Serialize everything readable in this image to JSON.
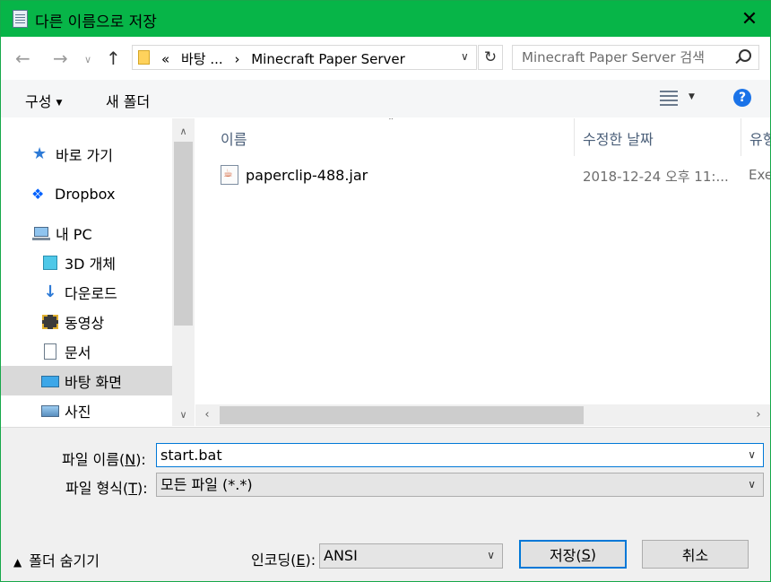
{
  "title_bar": {
    "title": "다른 이름으로 저장",
    "close_icon": "close-icon"
  },
  "address_bar": {
    "breadcrumbs": [
      "«",
      "바탕 ...",
      "›",
      "Minecraft Paper Server"
    ],
    "search_placeholder": "Minecraft Paper Server 검색"
  },
  "toolbar": {
    "organize_label": "구성",
    "new_folder_label": "새 폴더"
  },
  "nav_pane": {
    "items": [
      {
        "label": "바로 가기",
        "icon": "star-icon"
      },
      {
        "label": "Dropbox",
        "icon": "dropbox-icon"
      },
      {
        "label": "내 PC",
        "icon": "computer-icon"
      },
      {
        "label": "3D 개체",
        "icon": "cube-icon"
      },
      {
        "label": "다운로드",
        "icon": "download-icon"
      },
      {
        "label": "동영상",
        "icon": "video-icon"
      },
      {
        "label": "문서",
        "icon": "document-icon"
      },
      {
        "label": "바탕 화면",
        "icon": "desktop-icon",
        "selected": true
      },
      {
        "label": "사진",
        "icon": "pictures-icon"
      }
    ]
  },
  "file_list": {
    "columns": [
      "이름",
      "수정한 날짜",
      "유형"
    ],
    "files": [
      {
        "name": "paperclip-488.jar",
        "modified": "2018-12-24 오후 11:...",
        "type": "Exe"
      }
    ]
  },
  "form": {
    "filename_label_prefix": "파일 이름(",
    "filename_label_key": "N",
    "filename_label_suffix": "):",
    "filename_value": "start.bat",
    "filetype_label_prefix": "파일 형식(",
    "filetype_label_key": "T",
    "filetype_label_suffix": "):",
    "filetype_value": "모든 파일 (*.*)",
    "encoding_label_prefix": "인코딩(",
    "encoding_label_key": "E",
    "encoding_label_suffix": "):",
    "encoding_value": "ANSI",
    "hide_folders_label": "폴더 숨기기",
    "save_label_prefix": "저장(",
    "save_label_key": "S",
    "save_label_suffix": ")",
    "cancel_label": "취소"
  },
  "colors": {
    "title_bar": "#07b548",
    "accent": "#0078d7"
  }
}
